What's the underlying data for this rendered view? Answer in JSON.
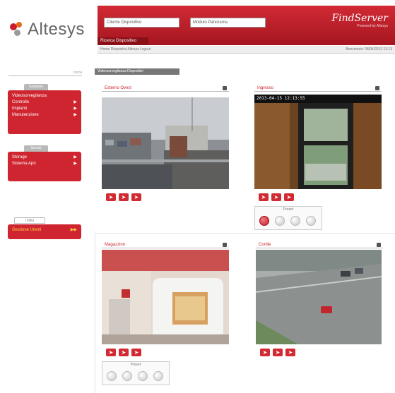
{
  "logo": {
    "text": "Altesys"
  },
  "header": {
    "select1": "Cliente Dispositivo",
    "select2": "Modulo Panorama",
    "brand_name": "FindServer",
    "brand_sub": "Powered by Altesys",
    "tab": "Ricerca Dispositivo"
  },
  "breadcrumb": {
    "left": "Home  Dispositivi Altesys Logout",
    "right": "Benvenuto: 08/04/2013 12:13"
  },
  "sidebar": {
    "search": "cerca",
    "group1_tab": "Gestione",
    "group1": [
      "Videosorveglianza",
      "Controllo",
      "Impianti",
      "Manutenzione"
    ],
    "group2_tab": "Servizi",
    "group2": [
      "Storage",
      "Sistema Apri"
    ],
    "group3_tab": "Utilita",
    "group3": [
      "Gestione Utenti"
    ]
  },
  "main": {
    "title": "Videosorveglianza Dispositivi"
  },
  "cameras": [
    {
      "name": "Esterno Ovest",
      "has_presets": false
    },
    {
      "name": "Ingresso",
      "timestamp": "2013-04-15 12:13:55",
      "has_presets": true,
      "presets_label": "Preset"
    },
    {
      "name": "Magazzino",
      "has_presets": true,
      "presets_label": "Preset"
    },
    {
      "name": "Cortile",
      "has_presets": false
    }
  ],
  "icons": {
    "ptz": "ptz-arrow-icon",
    "preset": "preset-button-icon",
    "gear": "gear-icon"
  },
  "colors": {
    "brand_red": "#cf2530",
    "header_dark": "#a51620"
  }
}
